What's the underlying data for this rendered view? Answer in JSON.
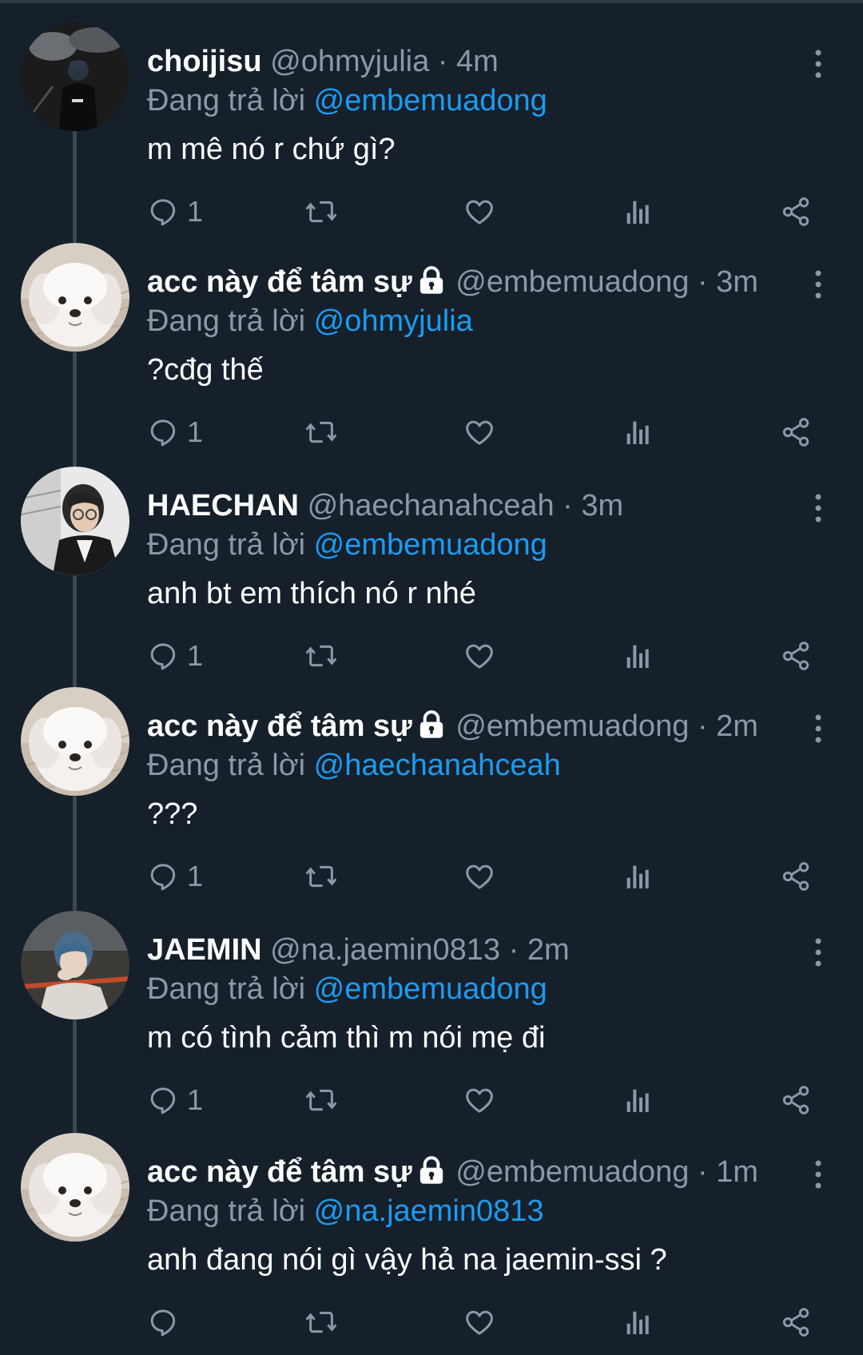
{
  "colors": {
    "background": "#15202b",
    "text": "#ffffff",
    "secondary": "#8b98a5",
    "mention": "#1d9bf0",
    "thread_line": "#3d4854"
  },
  "replying_prefix": "Đang trả lời",
  "tweets": [
    {
      "name": "choijisu",
      "handle": "@ohmyjulia",
      "dot": "·",
      "time": "4m",
      "locked": false,
      "reply_to": "@embemuadong",
      "text": "m mê nó r chứ gì?",
      "reply_count": "1",
      "avatar": "person-dark-avatar"
    },
    {
      "name": "acc này để tâm sự",
      "handle": "@embemuadong",
      "dot": "·",
      "time": "3m",
      "locked": true,
      "reply_to": "@ohmyjulia",
      "text": "?cđg thế",
      "reply_count": "1",
      "avatar": "white-dog-avatar"
    },
    {
      "name": "HAECHAN",
      "handle": "@haechanahceah",
      "dot": "·",
      "time": "3m",
      "locked": false,
      "reply_to": "@embemuadong",
      "text": "anh bt em thích nó r nhé",
      "reply_count": "1",
      "avatar": "person-glasses-avatar"
    },
    {
      "name": "acc này để tâm sự",
      "handle": "@embemuadong",
      "dot": "·",
      "time": "2m",
      "locked": true,
      "reply_to": "@haechanahceah",
      "text": "???",
      "reply_count": "1",
      "avatar": "white-dog-avatar"
    },
    {
      "name": "JAEMIN",
      "handle": "@na.jaemin0813",
      "dot": "·",
      "time": "2m",
      "locked": false,
      "reply_to": "@embemuadong",
      "text": "m có tình cảm thì m nói mẹ đi",
      "reply_count": "1",
      "avatar": "person-blue-hair-avatar"
    },
    {
      "name": "acc này để tâm sự",
      "handle": "@embemuadong",
      "dot": "·",
      "time": "1m",
      "locked": true,
      "reply_to": "@na.jaemin0813",
      "text": "anh đang nói gì vậy hả na jaemin-ssi ?",
      "reply_count": "",
      "avatar": "white-dog-avatar"
    }
  ]
}
